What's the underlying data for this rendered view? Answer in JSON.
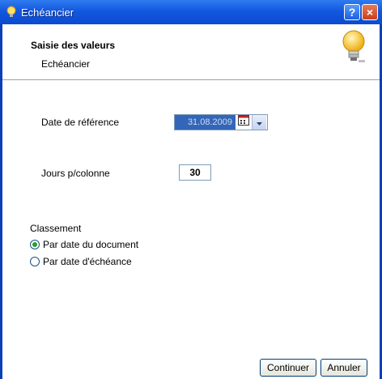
{
  "window": {
    "title": "Echéancier",
    "help": "?",
    "close": "×"
  },
  "header": {
    "title": "Saisie des valeurs",
    "subtitle": "Echéancier"
  },
  "form": {
    "date_label": "Date de référence",
    "date_value": "31.08.2009",
    "jours_label": "Jours p/colonne",
    "jours_value": "30",
    "classement_label": "Classement",
    "options": [
      {
        "label": "Par date du document",
        "selected": true
      },
      {
        "label": "Par date d'échéance",
        "selected": false
      }
    ]
  },
  "buttons": {
    "continue": "Continuer",
    "cancel": "Annuler"
  },
  "colors": {
    "titlebar": "#0a4ad0",
    "selection": "#3466b8",
    "radio_selected": "#22a030"
  }
}
